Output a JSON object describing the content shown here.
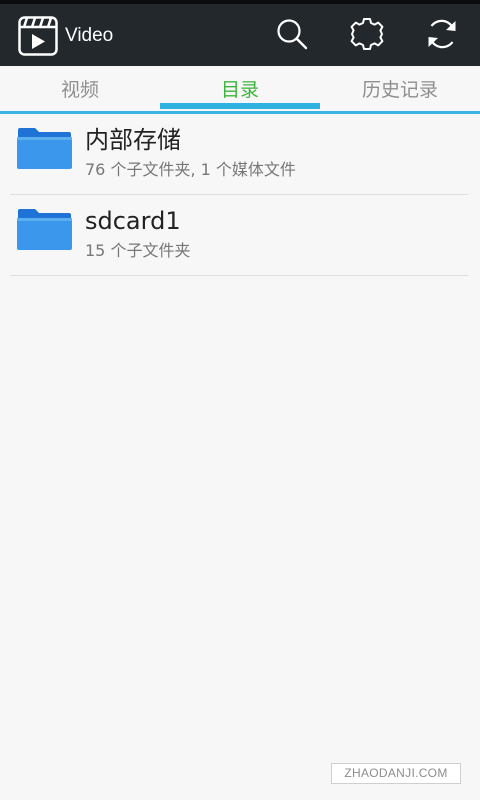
{
  "app": {
    "title": "Video",
    "logo_icon": "clapperboard-play-icon"
  },
  "actions": [
    {
      "icon": "search-icon"
    },
    {
      "icon": "gear-icon"
    },
    {
      "icon": "refresh-icon"
    }
  ],
  "tabs": [
    {
      "label": "视频",
      "active": false
    },
    {
      "label": "目录",
      "active": true
    },
    {
      "label": "历史记录",
      "active": false
    }
  ],
  "folders": [
    {
      "name": "内部存储",
      "details": "76 个子文件夹, 1 个媒体文件",
      "icon": "folder-icon"
    },
    {
      "name": "sdcard1",
      "details": "15 个子文件夹",
      "icon": "folder-icon"
    }
  ],
  "watermark": "ZHAODANJI.COM",
  "colors": {
    "appbar": "#22282c",
    "active_tab": "#3cb53c",
    "tab_indicator": "#2fb2e2",
    "folder": "#2f8ee8"
  }
}
